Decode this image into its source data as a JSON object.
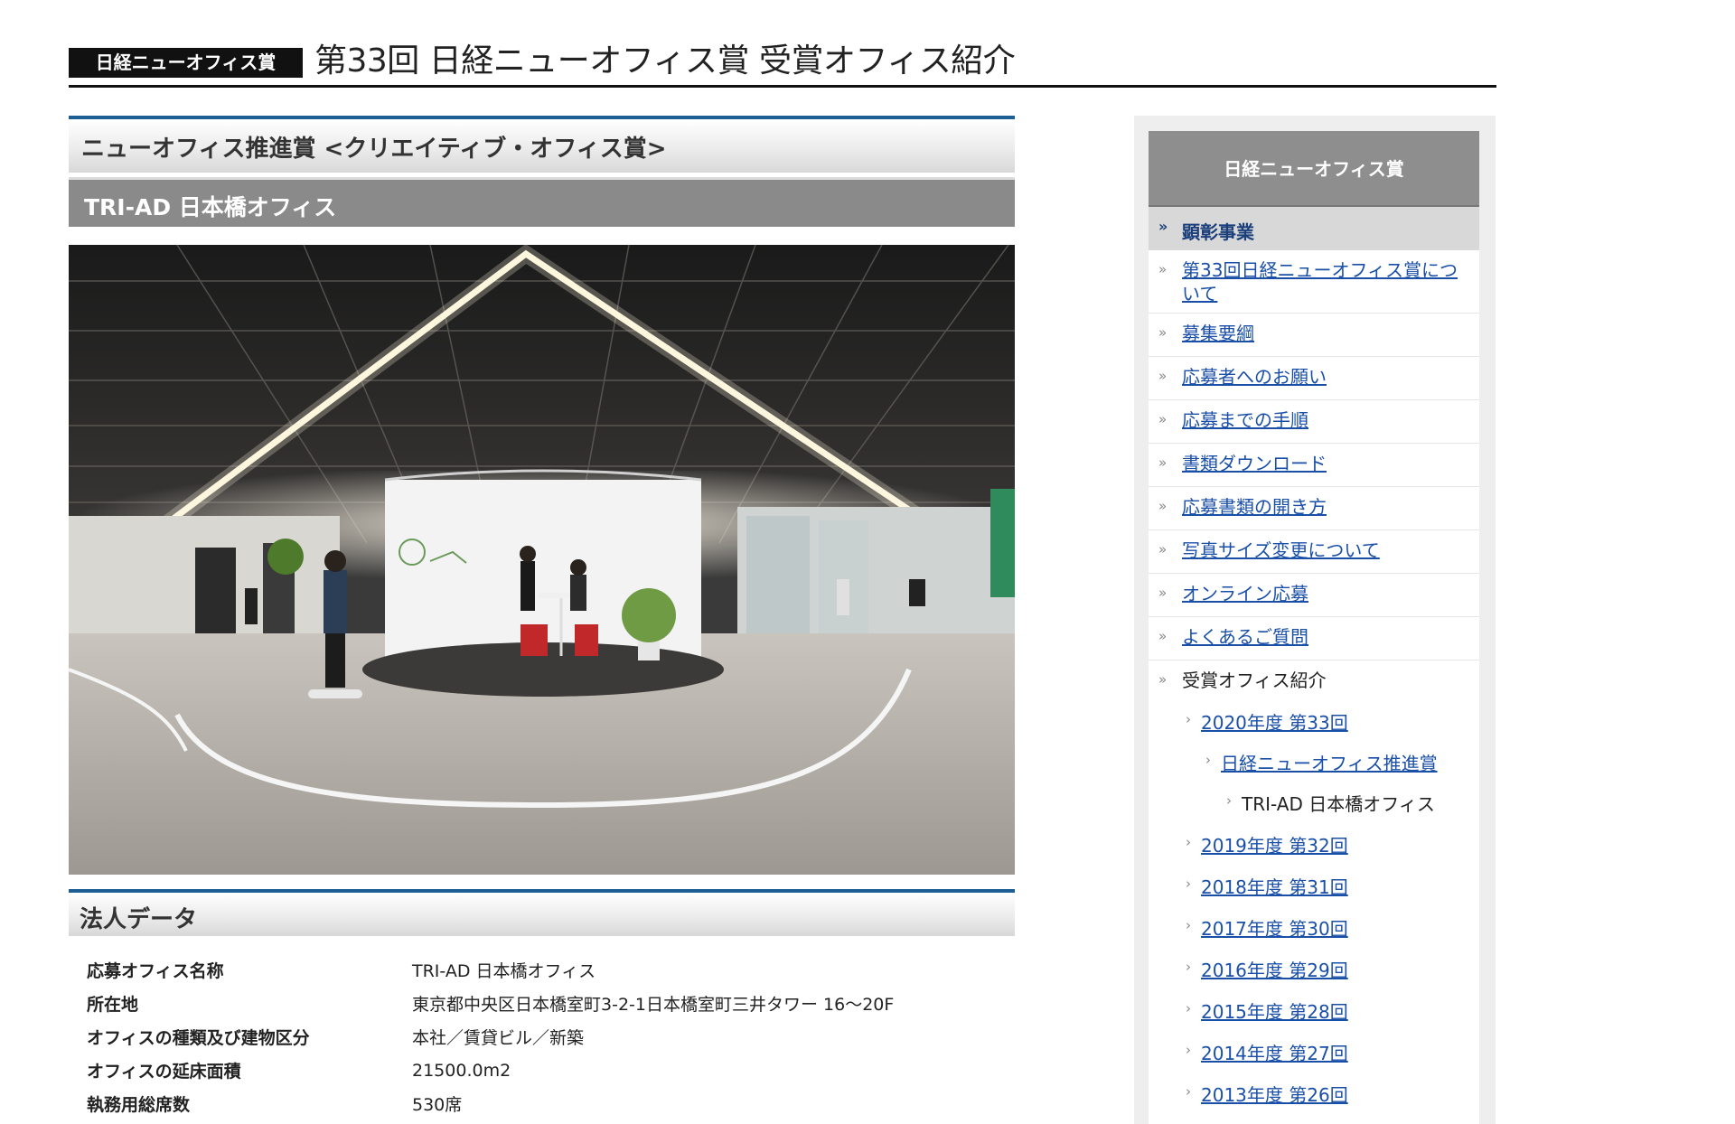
{
  "header": {
    "badge": "日経ニューオフィス賞",
    "title": "第33回 日経ニューオフィス賞 受賞オフィス紹介"
  },
  "main": {
    "award_heading": "ニューオフィス推進賞 <クリエイティブ・オフィス賞>",
    "office_name": "TRI-AD 日本橋オフィス",
    "photo_icon": "office-interior-photo",
    "corp_heading": "法人データ",
    "corp_rows": [
      {
        "label": "応募オフィス名称",
        "value": "TRI-AD 日本橋オフィス"
      },
      {
        "label": "所在地",
        "value": "東京都中央区日本橋室町3-2-1日本橋室町三井タワー 16～20F"
      },
      {
        "label": "オフィスの種類及び建物区分",
        "value": "本社／賃貸ビル／新築"
      },
      {
        "label": "オフィスの延床面積",
        "value": "21500.0m2"
      },
      {
        "label": "執務用総席数",
        "value": "530席"
      }
    ]
  },
  "sidebar": {
    "title": "日経ニューオフィス賞",
    "section": "顕彰事業",
    "section_icon": "double-chevron-down-icon",
    "items": [
      {
        "label": "第33回日経ニューオフィス賞について",
        "link": true
      },
      {
        "label": "募集要綱",
        "link": true
      },
      {
        "label": "応募者へのお願い",
        "link": true
      },
      {
        "label": "応募までの手順",
        "link": true
      },
      {
        "label": "書類ダウンロード",
        "link": true
      },
      {
        "label": "応募書類の開き方",
        "link": true
      },
      {
        "label": "写真サイズ変更について",
        "link": true
      },
      {
        "label": "オンライン応募",
        "link": true
      },
      {
        "label": "よくあるご質問",
        "link": true
      },
      {
        "label": "受賞オフィス紹介",
        "link": false
      }
    ],
    "sub_items": [
      {
        "label": "2020年度 第33回",
        "link": true
      },
      {
        "label": "日経ニューオフィス推進賞",
        "link": true
      },
      {
        "label": "TRI-AD 日本橋オフィス",
        "link": false
      },
      {
        "label": "2019年度 第32回",
        "link": true
      },
      {
        "label": "2018年度 第31回",
        "link": true
      },
      {
        "label": "2017年度 第30回",
        "link": true
      },
      {
        "label": "2016年度 第29回",
        "link": true
      },
      {
        "label": "2015年度 第28回",
        "link": true
      },
      {
        "label": "2014年度 第27回",
        "link": true
      },
      {
        "label": "2013年度 第26回",
        "link": true
      }
    ],
    "colors": {
      "link": "#1a4fa8",
      "accent": "#1d5f95",
      "panel": "#8e8e8e"
    }
  }
}
